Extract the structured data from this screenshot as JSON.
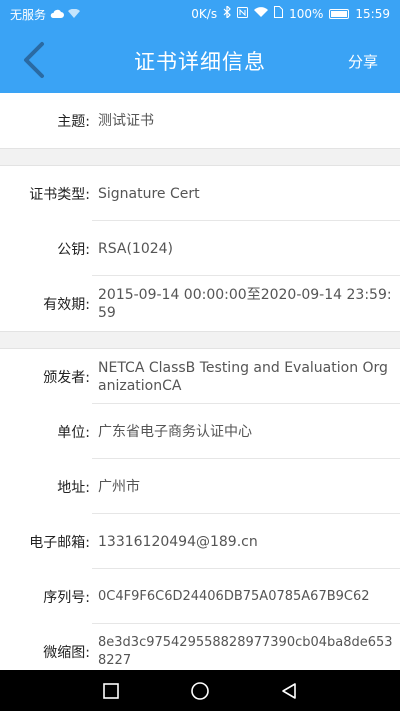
{
  "status_bar": {
    "carrier": "无服务",
    "speed": "0K/s",
    "battery": "100%",
    "time": "15:59"
  },
  "app_bar": {
    "title": "证书详细信息",
    "share_label": "分享"
  },
  "cert": {
    "subject": {
      "label": "主题:",
      "value": "测试证书"
    },
    "type": {
      "label": "证书类型:",
      "value": "Signature Cert"
    },
    "public_key": {
      "label": "公钥:",
      "value": "RSA(1024)"
    },
    "validity": {
      "label": "有效期:",
      "value": "2015-09-14 00:00:00至2020-09-14 23:59:59"
    },
    "issuer": {
      "label": "颁发者:",
      "value": "NETCA ClassB Testing and Evaluation OrganizationCA"
    },
    "organization": {
      "label": "单位:",
      "value": "广东省电子商务认证中心"
    },
    "address": {
      "label": "地址:",
      "value": "广州市"
    },
    "email": {
      "label": "电子邮箱:",
      "value": "13316120494@189.cn"
    },
    "serial": {
      "label": "序列号:",
      "value": "0C4F9F6C6D24406DB75A0785A67B9C62"
    },
    "thumbprint": {
      "label": "微缩图:",
      "value": "8e3d3c975429558828977390cb04ba8de6538227"
    }
  },
  "icons": {
    "back": "chevron-left-icon",
    "nav_recent": "square-icon",
    "nav_home": "circle-icon",
    "nav_back": "triangle-back-icon"
  }
}
